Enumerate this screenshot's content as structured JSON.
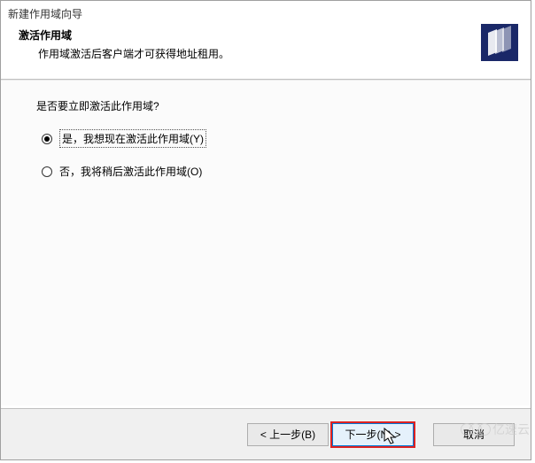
{
  "wizard": {
    "name": "新建作用域向导",
    "title": "激活作用域",
    "subtitle": "作用域激活后客户端才可获得地址租用。"
  },
  "content": {
    "question": "是否要立即激活此作用域?",
    "options": [
      {
        "label": "是，我想现在激活此作用域(Y)",
        "selected": true
      },
      {
        "label": "否，我将稍后激活此作用域(O)",
        "selected": false
      }
    ]
  },
  "buttons": {
    "back": "< 上一步(B)",
    "next": "下一步(N) >",
    "cancel": "取消"
  },
  "watermark": "亿速云"
}
